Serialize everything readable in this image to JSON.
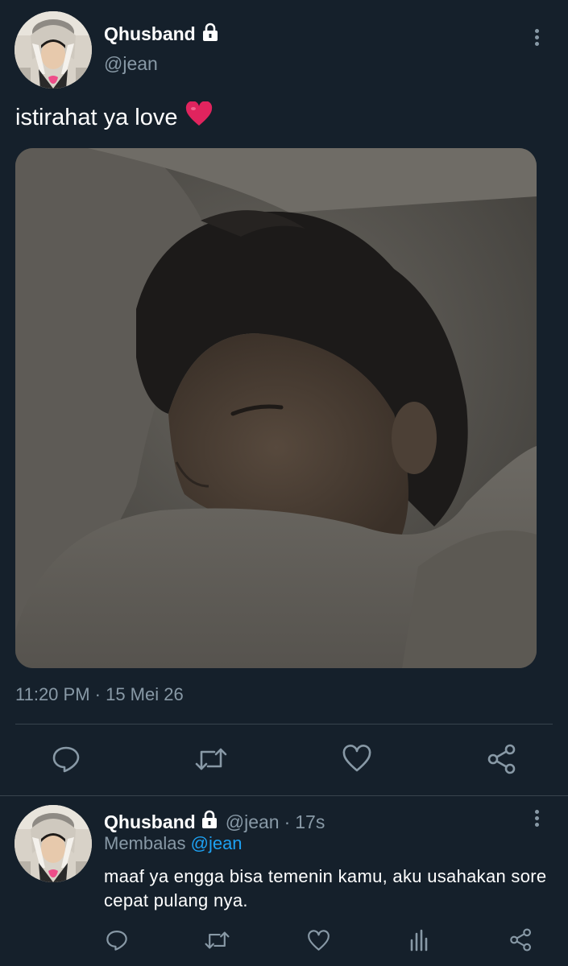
{
  "tweet": {
    "display_name": "Qhusband",
    "handle": "@jean",
    "text": "istirahat ya love",
    "emoji": "❤️",
    "timestamp": "11:20 PM · 15 Mei 26",
    "photo_alt": "sleeping-person-photo"
  },
  "actions": {
    "reply": "reply-icon",
    "retweet": "retweet-icon",
    "like": "heart-icon",
    "share": "share-icon"
  },
  "reply_tweet": {
    "display_name": "Qhusband",
    "handle": "@jean",
    "separator": "·",
    "time": "17s",
    "replying_prefix": "Membalas",
    "replying_to": "@jean",
    "text": "maaf ya engga bisa temenin kamu, aku usahakan sore cepat pulang nya."
  },
  "colors": {
    "background": "#15202b",
    "muted": "#8899a6",
    "link": "#1da1f2",
    "divider": "#38444d",
    "heart": "#e0245e"
  }
}
